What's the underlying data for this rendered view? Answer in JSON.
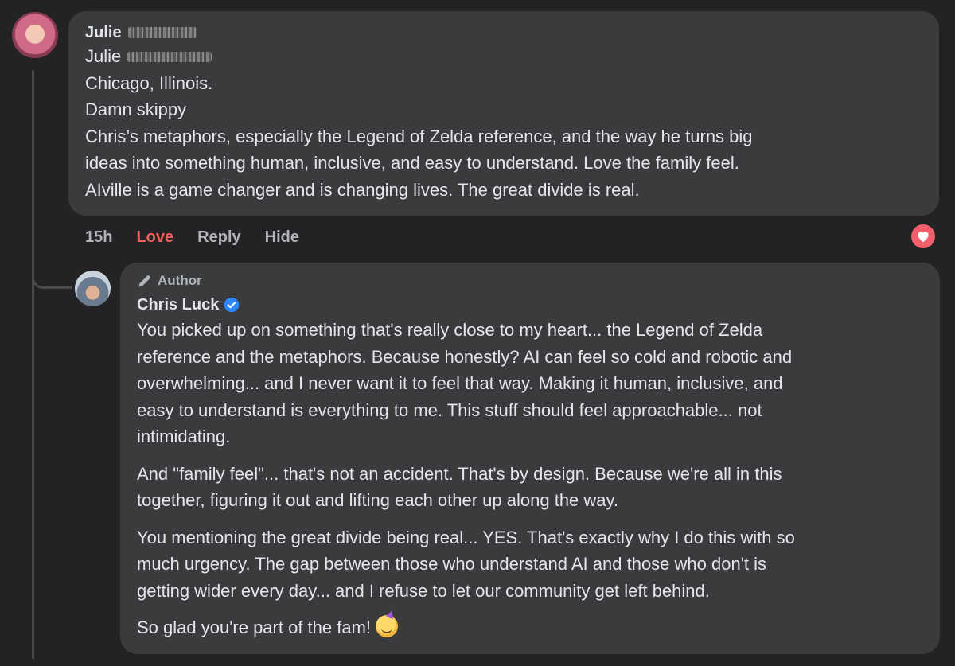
{
  "comment": {
    "author": "Julie",
    "lines": [
      "Julie",
      "Chicago, Illinois.",
      "Damn skippy",
      "Chris’s metaphors, especially the Legend of Zelda reference, and the way he turns big",
      "ideas into something human, inclusive, and easy to understand. Love the family feel.",
      "AIville is a game changer and is changing lives. The great divide is real."
    ],
    "time": "15h",
    "actions": {
      "love": "Love",
      "reply": "Reply",
      "hide": "Hide"
    },
    "reaction_icon": "heart-icon",
    "colors": {
      "love": "#f0615d",
      "reaction": "#f25e6a"
    }
  },
  "reply": {
    "badge": "Author",
    "author": "Chris Luck",
    "verified_icon": "verified-check-icon",
    "paragraphs": [
      {
        "lines": [
          "You picked up on something that's really close to my heart... the Legend of Zelda",
          "reference and the metaphors. Because honestly? AI can feel so cold and robotic and",
          "overwhelming... and I never want it to feel that way. Making it human, inclusive, and",
          "easy to understand is everything to me. This stuff should feel approachable... not",
          "intimidating."
        ]
      },
      {
        "lines": [
          "And \"family feel\"... that's not an accident. That's by design. Because we're all in this",
          "together, figuring it out and lifting each other up along the way."
        ]
      },
      {
        "lines": [
          "You mentioning the great divide being real... YES. That's exactly why I do this with so",
          "much urgency. The gap between those who understand AI and those who don't is",
          "getting wider every day... and I refuse to let our community get left behind."
        ]
      },
      {
        "lines": [
          "So glad you're part of the fam!"
        ],
        "emoji": "partying-face-emoji"
      }
    ]
  }
}
